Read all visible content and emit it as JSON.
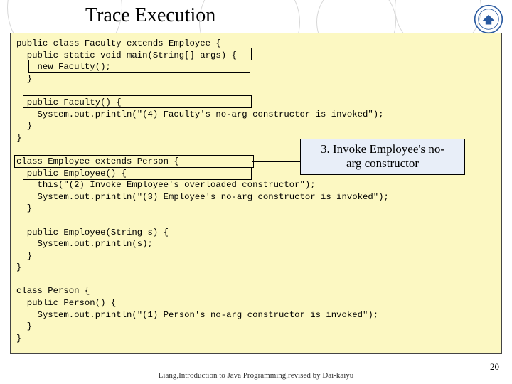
{
  "title": "Trace Execution",
  "code": "public class Faculty extends Employee {\n  public static void main(String[] args) {\n    new Faculty();\n  }\n\n  public Faculty() {\n    System.out.println(\"(4) Faculty's no-arg constructor is invoked\");\n  }\n}\n\nclass Employee extends Person {\n  public Employee() {\n    this(\"(2) Invoke Employee's overloaded constructor\");\n    System.out.println(\"(3) Employee's no-arg constructor is invoked\");\n  }\n\n  public Employee(String s) {\n    System.out.println(s);\n  }\n}\n\nclass Person {\n  public Person() {\n    System.out.println(\"(1) Person's no-arg constructor is invoked\");\n  }\n}",
  "callout": {
    "line1": "3. Invoke Employee's no-",
    "line2": "arg constructor"
  },
  "footer": "Liang,Introduction to Java Programming,revised by Dai-kaiyu",
  "pagenum": "20"
}
